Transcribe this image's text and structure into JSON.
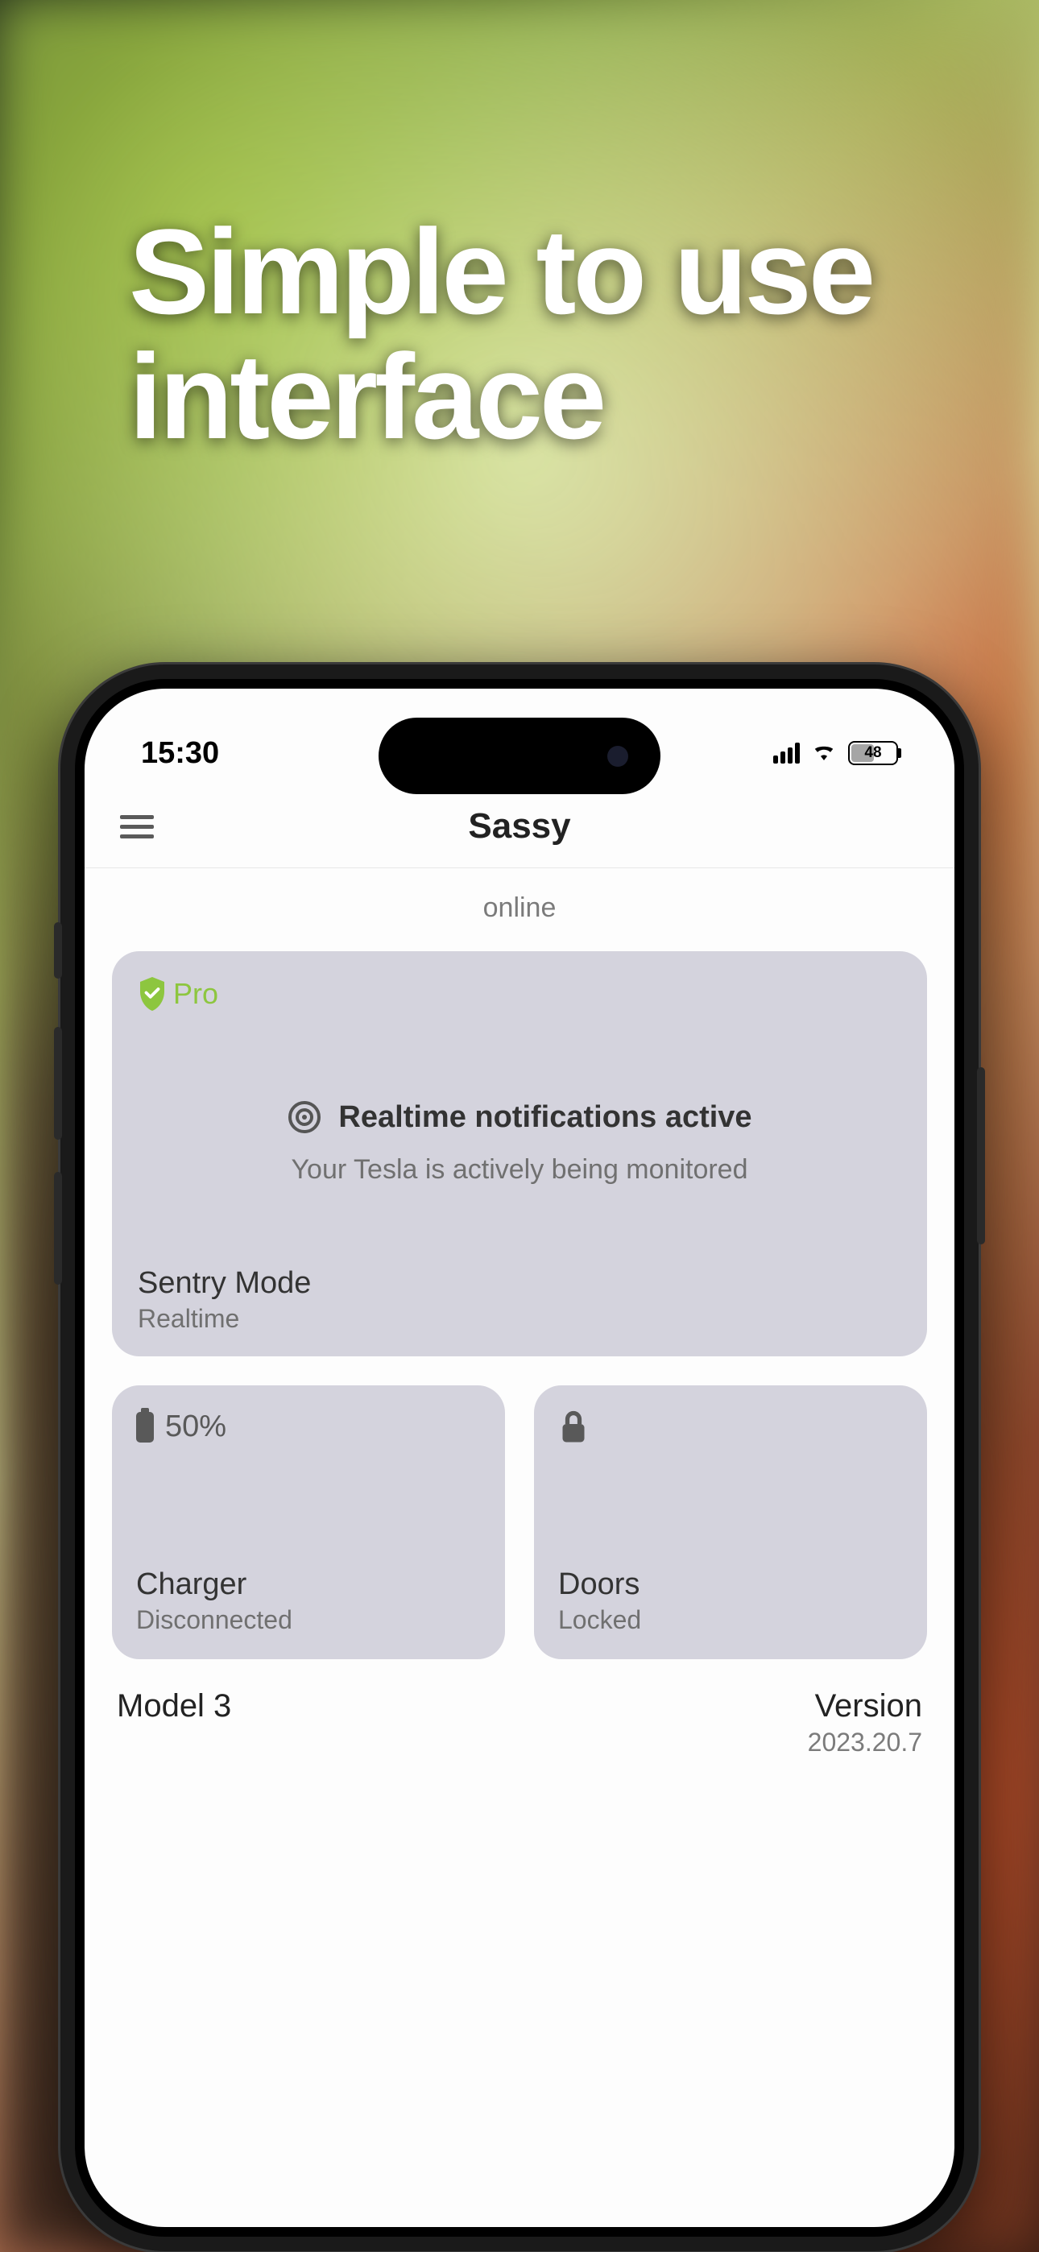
{
  "marketing": {
    "headline_l1": "Simple to use",
    "headline_l2": "interface"
  },
  "status_bar": {
    "time": "15:30",
    "battery_pct": "48"
  },
  "header": {
    "title": "Sassy"
  },
  "main": {
    "status": "online",
    "sentry": {
      "pro_label": "Pro",
      "notif_title": "Realtime notifications active",
      "notif_sub": "Your Tesla is actively being monitored",
      "title": "Sentry Mode",
      "subtitle": "Realtime"
    },
    "charger": {
      "battery_pct": "50%",
      "title": "Charger",
      "status": "Disconnected"
    },
    "doors": {
      "title": "Doors",
      "status": "Locked"
    },
    "info": {
      "model": "Model 3",
      "version_label": "Version",
      "version": "2023.20.7"
    }
  }
}
